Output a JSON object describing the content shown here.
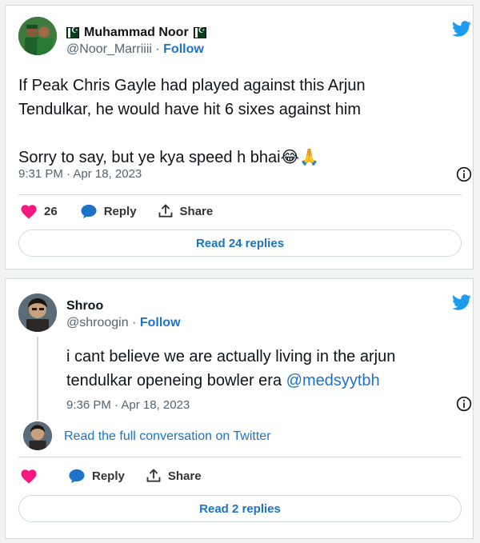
{
  "tweet1": {
    "author_name": "Muhammad Noor",
    "author_handle": "@Noor_Marriiii",
    "follow_label": "Follow",
    "separator": "·",
    "text": "If Peak Chris Gayle had played against this Arjun Tendulkar, he would have hit 6 sixes against him\n\nSorry to say, but ye kya speed h bhai😂🙏",
    "timestamp": "9:31 PM · Apr 18, 2023",
    "like_count": "26",
    "reply_label": "Reply",
    "share_label": "Share",
    "read_replies": "Read 24 replies"
  },
  "tweet2": {
    "author_name": "Shroo",
    "author_handle": "@shroogin",
    "follow_label": "Follow",
    "separator": "·",
    "text": "i cant believe we are actually living in the arjun tendulkar openeing bowler era ",
    "mention": "@medsyytbh",
    "timestamp": "9:36 PM · Apr 18, 2023",
    "conversation_link": "Read the full conversation on Twitter",
    "reply_label": "Reply",
    "share_label": "Share",
    "read_replies": "Read 2 replies"
  },
  "colors": {
    "accent": "#1d73c7",
    "twitter_blue": "#1d9bf0",
    "like_red": "#f91880",
    "text": "#0f1419",
    "muted": "#536471",
    "border": "#cfd9de"
  },
  "icons": {
    "brand": "twitter-bird-icon",
    "like": "heart-icon",
    "reply": "speech-bubble-icon",
    "share": "share-upload-icon",
    "info": "info-icon",
    "flag": "pakistan-flag-icon"
  }
}
